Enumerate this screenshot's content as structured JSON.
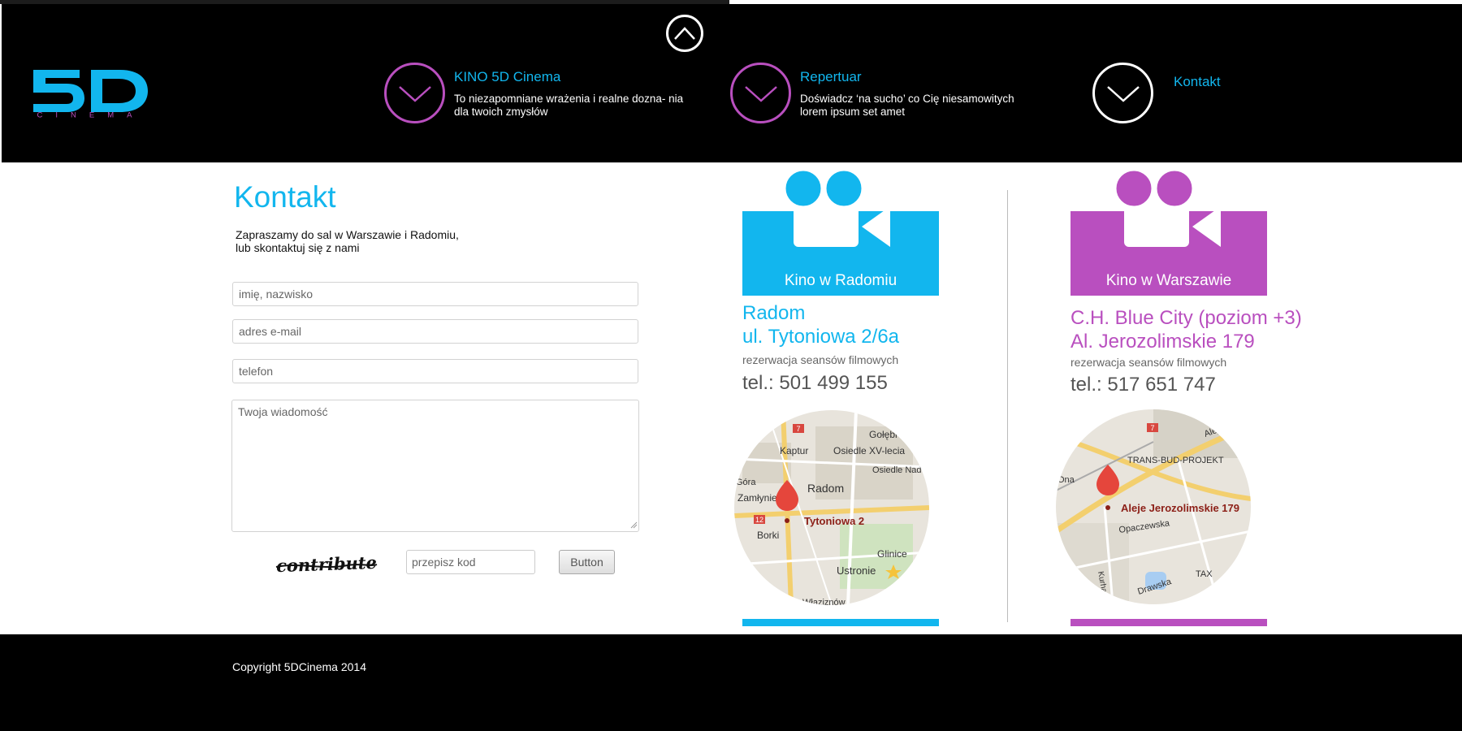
{
  "colors": {
    "accent_blue": "#12b6ee",
    "accent_purple": "#b94fbf",
    "header_bg": "#000000"
  },
  "header": {
    "logo": {
      "text": "5D",
      "subtext": "CINEMA"
    },
    "scroll_up_icon": "chevron-up-icon",
    "nav": [
      {
        "title": "KINO 5D Cinema",
        "description": "To niezapomniane wrażenia i realne dozna- nia dla twoich zmysłów",
        "icon": "chevron-down-icon"
      },
      {
        "title": "Repertuar",
        "description": "Doświadcz ‘na sucho’ co Cię niesamowitych lorem ipsum set amet",
        "icon": "chevron-down-icon"
      },
      {
        "title": "Kontakt",
        "description": "",
        "icon": "chevron-down-icon"
      }
    ]
  },
  "contact": {
    "heading": "Kontakt",
    "intro_line1": "Zapraszamy do sal w Warszawie i Radomiu,",
    "intro_line2": "lub skontaktuj się z nami",
    "name_placeholder": "imię, nazwisko",
    "email_placeholder": "adres e-mail",
    "phone_placeholder": "telefon",
    "message_placeholder": "Twoja wiadomość",
    "captcha_text": "contribute",
    "code_placeholder": "przepisz kod",
    "button_label": "Button"
  },
  "cinemas": [
    {
      "banner_label": "Kino w Radomiu",
      "line1": "Radom",
      "line2": "ul. Tytoniowa 2/6a",
      "reservation": "rezerwacja seansów filmowych",
      "phone": "tel.: 501 499 155",
      "color": "#12b6ee",
      "map": {
        "labels": [
          "Gołębi",
          "Kaptur",
          "Osiedle XV-lecia",
          "Osiedle Nad",
          "Radom",
          "Zamłynie",
          "Góra",
          "Borki",
          "Glinice",
          "Ustronie",
          "Właziznów"
        ],
        "pin_label": "Tytoniowa 2",
        "road_numbers": [
          "7",
          "12"
        ]
      }
    },
    {
      "banner_label": "Kino w Warszawie",
      "line1": "C.H. Blue City (poziom +3)",
      "line2": "Al. Jerozolimskie 179",
      "reservation": "rezerwacja seansów filmowych",
      "phone": "tel.: 517 651 747",
      "color": "#b94fbf",
      "map": {
        "labels": [
          "Aleje J",
          "TRANS-BUD-PROJEKT",
          "Ona",
          "Opaczewska",
          "Kurhan",
          "Drawska",
          "TAX"
        ],
        "pin_label": "Aleje Jerozolimskie 179",
        "road_numbers": [
          "7"
        ]
      }
    }
  ],
  "footer": {
    "copyright": "Copyright 5DCinema 2014"
  }
}
